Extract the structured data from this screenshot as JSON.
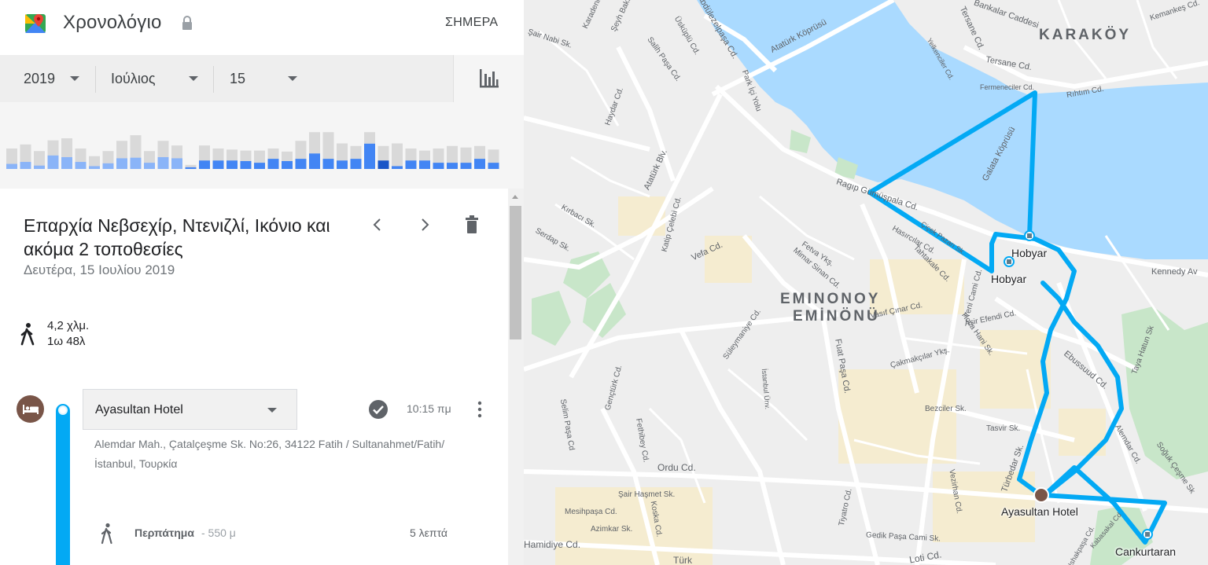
{
  "header": {
    "title": "Χρονολόγιο",
    "today_label": "ΣΗΜΕΡΑ"
  },
  "date_picker": {
    "year": "2019",
    "month": "Ιούλιος",
    "day": "15"
  },
  "histogram": {
    "days": [
      {
        "total": 0.4,
        "active": 0.18
      },
      {
        "total": 0.48,
        "active": 0.25
      },
      {
        "total": 0.35,
        "active": 0.12
      },
      {
        "total": 0.56,
        "active": 0.48
      },
      {
        "total": 0.6,
        "active": 0.42
      },
      {
        "total": 0.4,
        "active": 0.25
      },
      {
        "total": 0.25,
        "active": 0.1
      },
      {
        "total": 0.35,
        "active": 0.2
      },
      {
        "total": 0.55,
        "active": 0.38
      },
      {
        "total": 0.66,
        "active": 0.4
      },
      {
        "total": 0.35,
        "active": 0.22
      },
      {
        "total": 0.55,
        "active": 0.42
      },
      {
        "total": 0.46,
        "active": 0.38
      },
      {
        "total": 0.08,
        "active": 0.06
      },
      {
        "total": 0.46,
        "active": 0.3
      },
      {
        "total": 0.4,
        "active": 0.3
      },
      {
        "total": 0.38,
        "active": 0.3
      },
      {
        "total": 0.36,
        "active": 0.28
      },
      {
        "total": 0.36,
        "active": 0.22
      },
      {
        "total": 0.4,
        "active": 0.36
      },
      {
        "total": 0.34,
        "active": 0.28
      },
      {
        "total": 0.55,
        "active": 0.36
      },
      {
        "total": 0.72,
        "active": 0.55
      },
      {
        "total": 0.72,
        "active": 0.36
      },
      {
        "total": 0.5,
        "active": 0.3
      },
      {
        "total": 0.45,
        "active": 0.36
      },
      {
        "total": 0.72,
        "active": 0.9
      },
      {
        "total": 0.45,
        "active": 0.3
      },
      {
        "total": 0.5,
        "active": 0.1
      },
      {
        "total": 0.4,
        "active": 0.3
      },
      {
        "total": 0.36,
        "active": 0.3
      },
      {
        "total": 0.4,
        "active": 0.22
      },
      {
        "total": 0.45,
        "active": 0.22
      },
      {
        "total": 0.42,
        "active": 0.22
      },
      {
        "total": 0.45,
        "active": 0.36
      },
      {
        "total": 0.38,
        "active": 0.22
      }
    ],
    "selected_index": 27
  },
  "day": {
    "title": "Επαρχία Νεβσεχίρ, Ντενιζλί, Ικόνιο και ακόμα 2 τοποθεσίες",
    "date": "Δευτέρα, 15 Ιουλίου 2019",
    "distance": "4,2 χλμ.",
    "duration": "1ω 48λ"
  },
  "visit": {
    "place": "Ayasultan Hotel",
    "time": "10:15 πμ",
    "address": "Alemdar Mah., Çatalçeşme Sk. No:26, 34122 Fatih / Sultanahmet/Fatih/İstanbul, Τουρκία"
  },
  "leg": {
    "mode": "Περπάτημα",
    "distance": "- 550 μ",
    "duration": "5 λεπτά"
  },
  "map": {
    "districts": [
      {
        "name": "KARAKÖY"
      },
      {
        "name": "EMINONOY"
      },
      {
        "name": "EMİNÖNÜ"
      }
    ],
    "pois": [
      {
        "name": "Hobyar"
      },
      {
        "name": "Hobyar"
      },
      {
        "name": "Ayasultan Hotel"
      },
      {
        "name": "Cankurtaran"
      }
    ],
    "streets": [
      "Atatürk Köprüsü",
      "Tersane Cd.",
      "Bankalar Caddesi",
      "Tersane Cd.",
      "Fermeneciler Cd.",
      "Rıhtım Cd.",
      "Kemankeş Cd.",
      "Galata Köprüsü",
      "Ragıp Gümüşpala Cd.",
      "Kennedy Av",
      "Atatürk Blv.",
      "Fetva Ykş.",
      "Mimar Sinan Cd.",
      "Vefa Cd.",
      "Vasıf Çınar Cd.",
      "Aşir Efendi Cd.",
      "Hoca Hani Sk.",
      "Ebussuud Cd.",
      "Fuat Paşa Cd.",
      "Süleymaniye Cd.",
      "Çakmakçılar Ykş.",
      "Bezciler Sk.",
      "Tasvir Sk.",
      "Ordu Cd.",
      "Türbedar Sk.",
      "Vezirhan Cd.",
      "Alemdar Cd.",
      "Soğuk Çeşme Sk",
      "Gedik Paşa Cami Sk.",
      "Şair Haşmet Sk.",
      "Mesihpaşa Cd.",
      "Azimkar Sk.",
      "Koska Cd.",
      "Tiyatro Cd.",
      "Fethibey Cd.",
      "Gençtürk Cd.",
      "Selim Paşa Cd",
      "Katip Çelebi Cd.",
      "Kırbacı Sk.",
      "Serdap Sk.",
      "Haydar Cd.",
      "Salih Paşa Cd.",
      "Şair Nabi Sk.",
      "Karadeniz",
      "Şeyh Bakır",
      "Üsküplü Cd.",
      "Abdülezelpaşa Cd.",
      "Park İçi Yolu",
      "Yelkenciler Cd.",
      "Taya Hatun Sk",
      "Hasırcılar Cd.",
      "Tahtakale Cd.",
      "Yeni Cami Cd.",
      "Çiçek Pazarı Sk.",
      "İstanbul Ünv.",
      "Loti Cd.",
      "Türk",
      "Kabasakal Cd",
      "Ishakpaşa Cd.",
      "Hamidiye Cd."
    ]
  },
  "colors": {
    "route": "#03a9f4",
    "water": "#aadaff",
    "park": "#c8e6c9",
    "hotel": "#795548",
    "bar_total": "#d9d9d9",
    "bar_active": "#4285f4",
    "bar_selected": "#1a56c8",
    "bar_light": "#8ab4f8"
  }
}
